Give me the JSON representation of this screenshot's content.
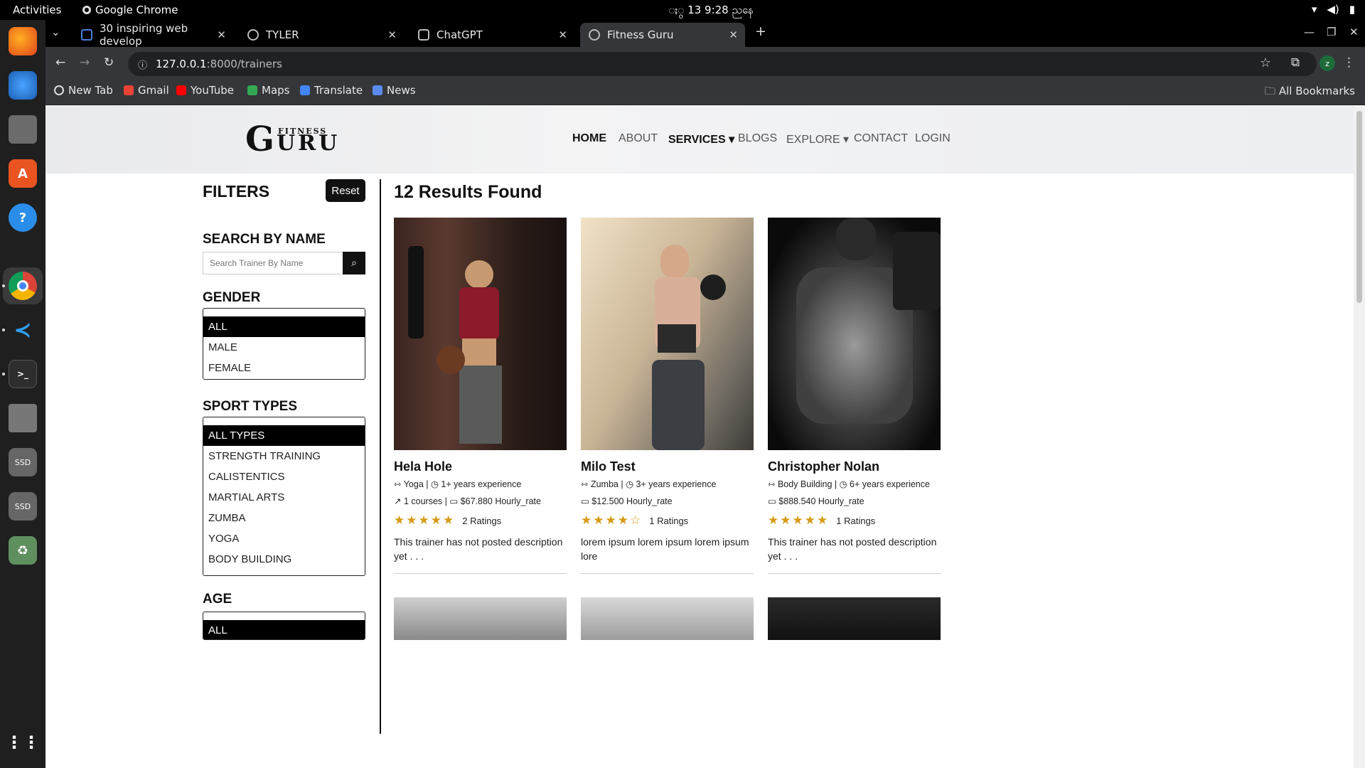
{
  "system_bar": {
    "activities": "Activities",
    "app": "Google Chrome",
    "clock": "ႏွ 13  9:28 ညနေ"
  },
  "tabs": [
    {
      "label": "30 inspiring web develop"
    },
    {
      "label": "TYLER"
    },
    {
      "label": "ChatGPT"
    },
    {
      "label": "Fitness Guru"
    }
  ],
  "address": {
    "host": "127.0.0.1",
    "path": ":8000/trainers",
    "profile": "z"
  },
  "bookmarks": [
    {
      "label": "New Tab"
    },
    {
      "label": "Gmail"
    },
    {
      "label": "YouTube"
    },
    {
      "label": "Maps"
    },
    {
      "label": "Translate"
    },
    {
      "label": "News"
    }
  ],
  "all_bookmarks": "All Bookmarks",
  "site": {
    "logo_top": "FITNESS",
    "logo_main": "G",
    "logo_rest": "URU",
    "nav": [
      "HOME",
      "ABOUT",
      "SERVICES",
      "BLOGS",
      "EXPLORE",
      "CONTACT",
      "LOGIN"
    ]
  },
  "filters": {
    "title": "FILTERS",
    "reset": "Reset",
    "search_title": "SEARCH BY NAME",
    "search_placeholder": "Search Trainer By Name",
    "gender_title": "GENDER",
    "gender_options": [
      "ALL",
      "MALE",
      "FEMALE"
    ],
    "sport_title": "SPORT TYPES",
    "sport_options": [
      "ALL TYPES",
      "STRENGTH TRAINING",
      "CALISTENTICS",
      "MARTIAL ARTS",
      "ZUMBA",
      "YOGA",
      "BODY BUILDING"
    ],
    "age_title": "AGE",
    "age_selected": "ALL"
  },
  "results_title": "12 Results Found",
  "trainers": [
    {
      "name": "Hela Hole",
      "sport": "Yoga",
      "experience": "1+ years experience",
      "courses": "1 courses",
      "rate": "$67.880 Hourly_rate",
      "stars": 5,
      "ratings": "2 Ratings",
      "description": "This trainer has not posted description yet . . ."
    },
    {
      "name": "Milo Test",
      "sport": "Zumba",
      "experience": "3+ years experience",
      "courses": "",
      "rate": "$12.500 Hourly_rate",
      "stars": 4,
      "ratings": "1 Ratings",
      "description": "lorem ipsum lorem ipsum lorem ipsum lore"
    },
    {
      "name": "Christopher Nolan",
      "sport": "Body Building",
      "experience": "6+ years experience",
      "courses": "",
      "rate": "$888.540 Hourly_rate",
      "stars": 5,
      "ratings": "1 Ratings",
      "description": "This trainer has not posted description yet . . ."
    }
  ],
  "colors": {
    "star": "#d69a16",
    "dark": "#111111",
    "header_bg": "#eceef1"
  }
}
